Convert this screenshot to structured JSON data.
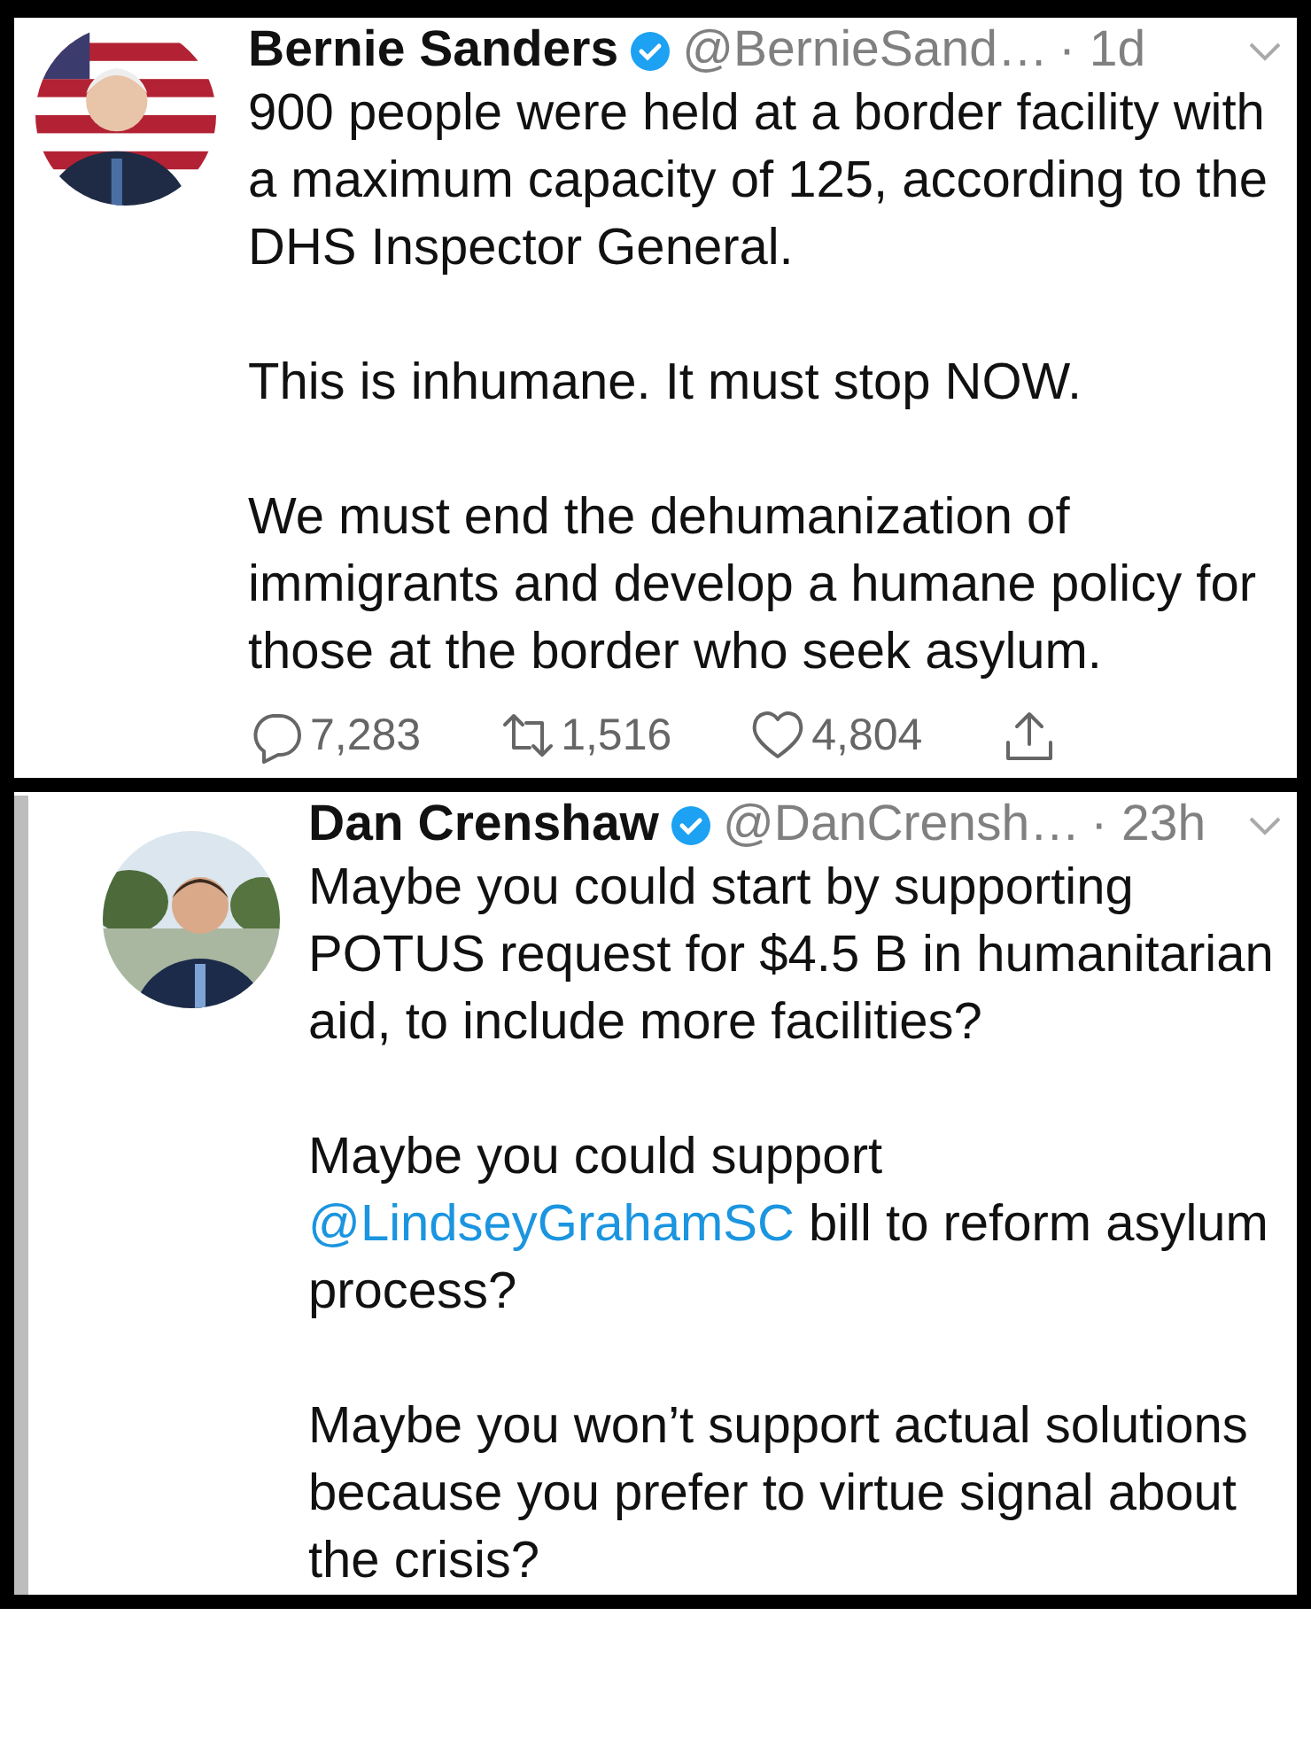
{
  "tweets": [
    {
      "name": "Bernie Sanders",
      "verified": true,
      "handle": "@BernieSand…",
      "time": "· 1d",
      "kind": "original",
      "paragraphs": [
        [
          {
            "kind": "text",
            "text": "900 people were held at a border facility with a maximum capacity of 125, according to the DHS Inspector General."
          }
        ],
        [
          {
            "kind": "text",
            "text": "This is inhumane. It must stop NOW."
          }
        ],
        [
          {
            "kind": "text",
            "text": "We must end the dehumanization of immigrants and develop a humane policy for those at the border who seek asylum."
          }
        ]
      ],
      "actions": [
        {
          "kind": "reply",
          "count": "7,283"
        },
        {
          "kind": "retweet",
          "count": "1,516"
        },
        {
          "kind": "like",
          "count": "4,804"
        },
        {
          "kind": "share"
        }
      ]
    },
    {
      "name": "Dan Crenshaw",
      "verified": true,
      "handle": "@DanCrensh…",
      "time": "· 23h",
      "kind": "reply",
      "paragraphs": [
        [
          {
            "kind": "text",
            "text": "Maybe you could start by supporting POTUS request for $4.5 B in humanitarian aid, to include more facilities?"
          }
        ],
        [
          {
            "kind": "text",
            "text": "Maybe you could support "
          },
          {
            "kind": "mention",
            "text": "@LindseyGrahamSC"
          },
          {
            "kind": "text",
            "text": " bill to reform asylum process?"
          }
        ],
        [
          {
            "kind": "text",
            "text": "Maybe you won’t support actual solutions because you prefer to virtue signal about the crisis?"
          }
        ]
      ]
    }
  ]
}
